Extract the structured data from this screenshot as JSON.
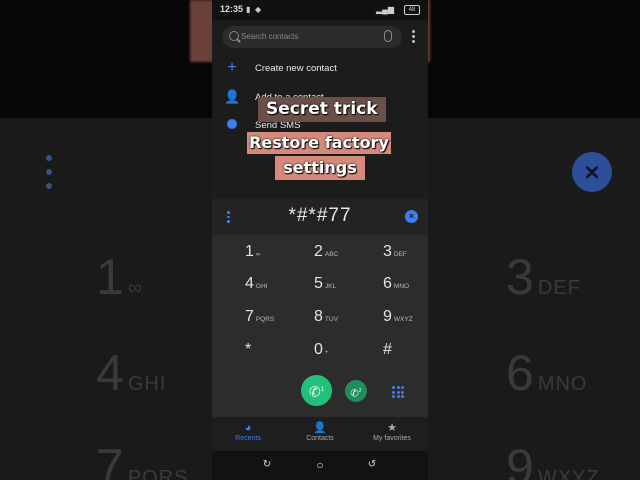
{
  "status_bar": {
    "time": "12:35",
    "battery": "48"
  },
  "search": {
    "placeholder": "Search contacts"
  },
  "menu": [
    {
      "label": "Create new contact",
      "icon": "plus-icon"
    },
    {
      "label": "Add to a contact",
      "icon": "add-person-icon"
    },
    {
      "label": "Send SMS",
      "icon": "message-icon"
    }
  ],
  "dialer": {
    "number": "*#*#77",
    "keys": [
      {
        "digit": "1",
        "letters": "∞"
      },
      {
        "digit": "2",
        "letters": "ABC"
      },
      {
        "digit": "3",
        "letters": "DEF"
      },
      {
        "digit": "4",
        "letters": "GHI"
      },
      {
        "digit": "5",
        "letters": "JKL"
      },
      {
        "digit": "6",
        "letters": "MNO"
      },
      {
        "digit": "7",
        "letters": "PQRS"
      },
      {
        "digit": "8",
        "letters": "TUV"
      },
      {
        "digit": "9",
        "letters": "WXYZ"
      },
      {
        "digit": "*",
        "letters": ""
      },
      {
        "digit": "0",
        "letters": "+"
      },
      {
        "digit": "#",
        "letters": ""
      }
    ],
    "sim1_label": "1",
    "sim2_label": "2"
  },
  "tabs": [
    {
      "label": "Recents",
      "active": true
    },
    {
      "label": "Contacts",
      "active": false
    },
    {
      "label": "My favorites",
      "active": false
    }
  ],
  "overlay": {
    "line1": "Secret trick",
    "line2": "Restore factory",
    "line3": "settings"
  },
  "background": {
    "keys": [
      {
        "digit": "1",
        "letters": "∞"
      },
      {
        "digit": "3",
        "letters": "DEF"
      },
      {
        "digit": "4",
        "letters": "GHI"
      },
      {
        "digit": "6",
        "letters": "MNO"
      },
      {
        "digit": "7",
        "letters": "PQRS"
      },
      {
        "digit": "9",
        "letters": "WXYZ"
      }
    ]
  },
  "colors": {
    "accent": "#3d7ef0",
    "call": "#21c17a",
    "caption_bg": "#d68a7c"
  }
}
